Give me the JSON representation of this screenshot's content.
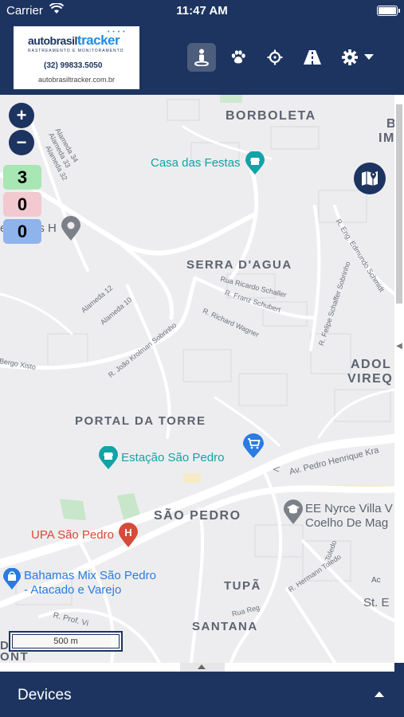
{
  "status_bar": {
    "carrier": "Carrier",
    "time": "11:47 AM"
  },
  "header": {
    "logo": {
      "brand_prefix": "autobrasil",
      "brand_suffix": "tracker",
      "tagline": "RASTREAMENTO E MONITORAMENTO",
      "phone": "(32) 99833.5050",
      "website": "autobrasiltracker.com.br"
    },
    "buttons": [
      "street-view",
      "paw",
      "crosshair",
      "road",
      "settings"
    ]
  },
  "map": {
    "zoom_in": "+",
    "zoom_out": "−",
    "counters": [
      {
        "value": "3",
        "color": "#a8e6b4"
      },
      {
        "value": "0",
        "color": "#f2c9cf"
      },
      {
        "value": "0",
        "color": "#8fb4ec"
      }
    ],
    "neighborhoods": {
      "borboleta": "BORBOLETA",
      "serra_dagua": "SERRA D'AGUA",
      "portal_da_torre": "PORTAL DA TORRE",
      "sao_pedro": "SÃO PEDRO",
      "tupa": "TUPÃ",
      "santana": "SANTANA",
      "adolfo_line1": "ADOL",
      "adolfo_line2": "VIREQ",
      "right_b": "B",
      "right_im": "IM",
      "left_ont": "ONT",
      "left_d": "D"
    },
    "pois": {
      "casa_festas": "Casa das Festas",
      "acessorios": "essorios H",
      "estacao": "Estação São Pedro",
      "upa": "UPA São Pedro",
      "bahamas_line1": "Bahamas Mix São Pedro",
      "bahamas_line2": "- Atacado e Varejo",
      "ee_line1": "EE Nyrce Villa V",
      "ee_line2": "Coelho De Mag",
      "st_e": "St. E",
      "ac": "Ac"
    },
    "streets": {
      "alameda34": "Alameda 34",
      "alameda33": "Alameda 33",
      "alameda32": "Alameda 32",
      "alameda12": "Alameda 12",
      "alameda10": "Alameda 10",
      "ricardo_schaller": "Rua Ricardo Schaller",
      "franz_schubert": "R. Franz Schubert",
      "richard_wagner": "R. Richard Wagner",
      "felipe_schaffer": "R. Felipe Schaffer Sobrinho",
      "eng_edmundo": "R. Eng. Edmundo Schmidt",
      "joao_krolman": "R. João Krolman Sobrinho",
      "bergo_xisto": "Bergo Xisto",
      "pedro_henrique": "Av. Pedro Henrique Kra",
      "herman_toledo": "R. Hermann Toledo",
      "rua_reg": "Rua Reg",
      "prof_vi": "R. Prof. Vi"
    },
    "scale": "500 m"
  },
  "devices_panel": {
    "label": "Devices"
  }
}
